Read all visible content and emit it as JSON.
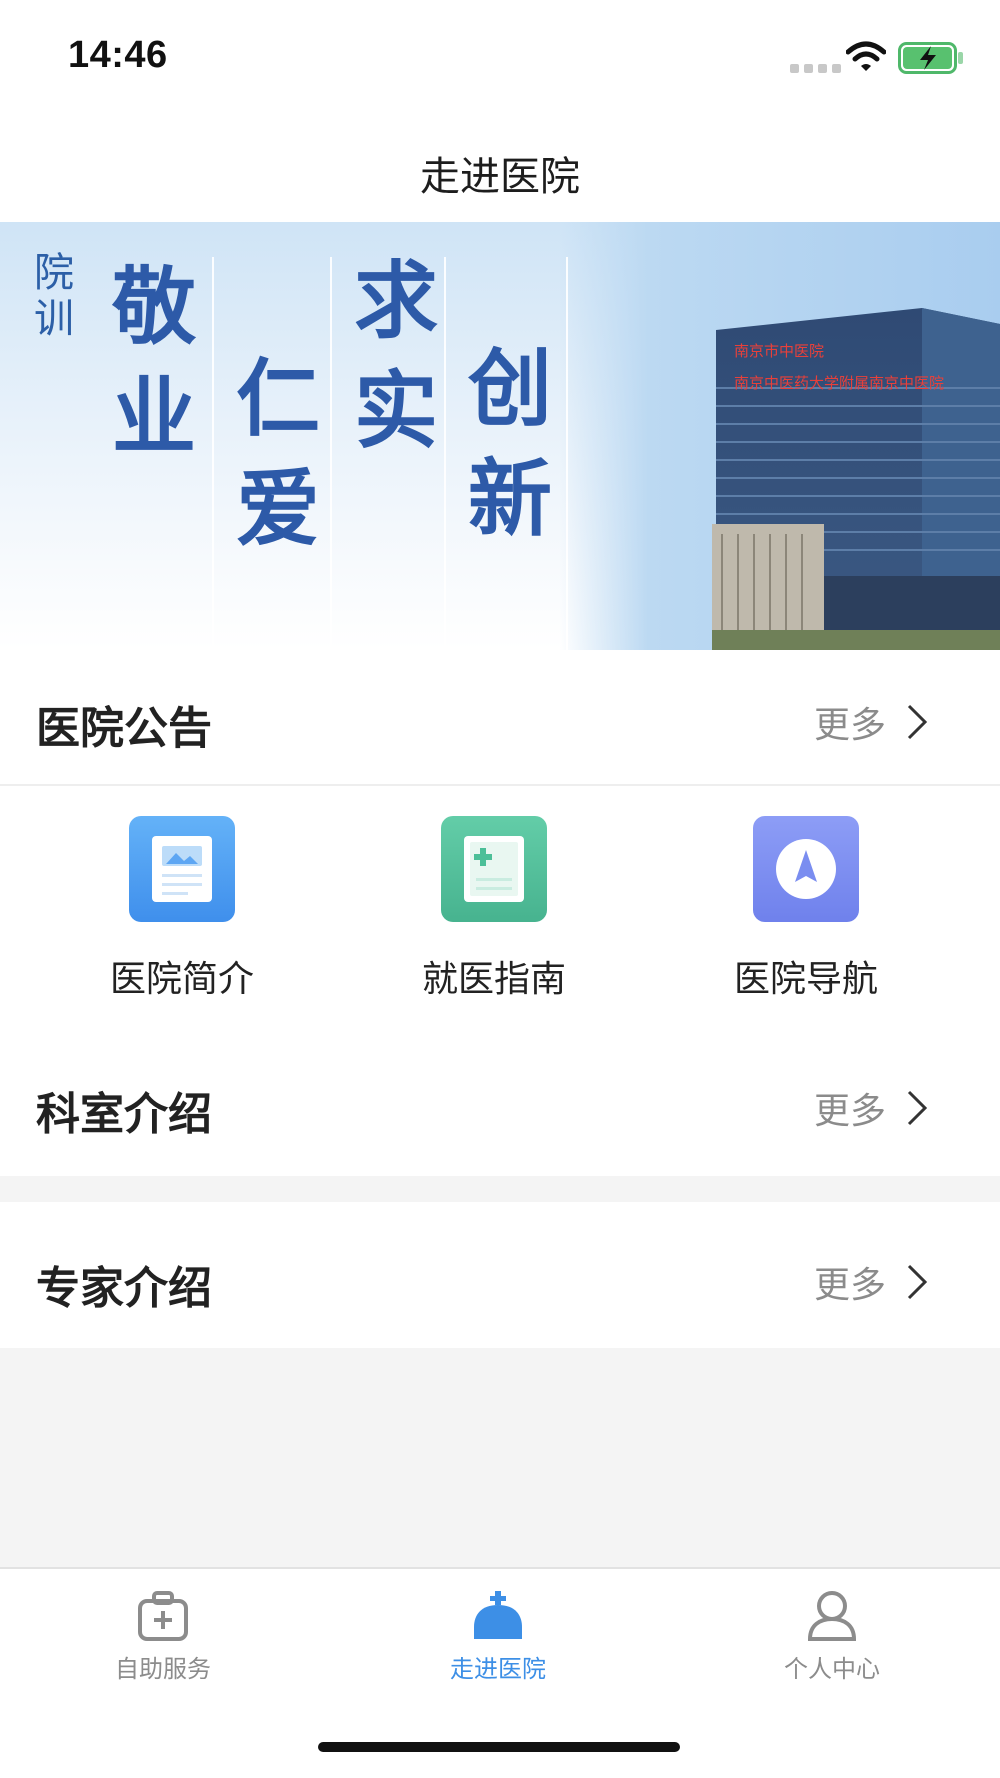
{
  "status_bar": {
    "time": "14:46"
  },
  "nav": {
    "title": "走进医院"
  },
  "banner": {
    "motto_label": "院训",
    "motto_words": [
      "敬业",
      "仁爱",
      "求实",
      "创新"
    ],
    "building_sign_1": "南京市中医院",
    "building_sign_2": "南京中医药大学附属南京中医院"
  },
  "sections": {
    "announcements": {
      "title": "医院公告",
      "more": "更多"
    },
    "departments": {
      "title": "科室介绍",
      "more": "更多"
    },
    "experts": {
      "title": "专家介绍",
      "more": "更多"
    }
  },
  "quick_links": [
    {
      "label": "医院简介",
      "icon": "document-image-icon",
      "color": "#4a9bf0"
    },
    {
      "label": "就医指南",
      "icon": "medical-guide-icon",
      "color": "#4cbf98"
    },
    {
      "label": "医院导航",
      "icon": "compass-icon",
      "color": "#7a8df0"
    }
  ],
  "tab_bar": {
    "items": [
      {
        "label": "自助服务",
        "icon": "medical-kit-icon",
        "active": false
      },
      {
        "label": "走进医院",
        "icon": "hospital-icon",
        "active": true
      },
      {
        "label": "个人中心",
        "icon": "user-icon",
        "active": false
      }
    ],
    "active_color": "#3d8fe6",
    "inactive_color": "#8c8c8c"
  }
}
